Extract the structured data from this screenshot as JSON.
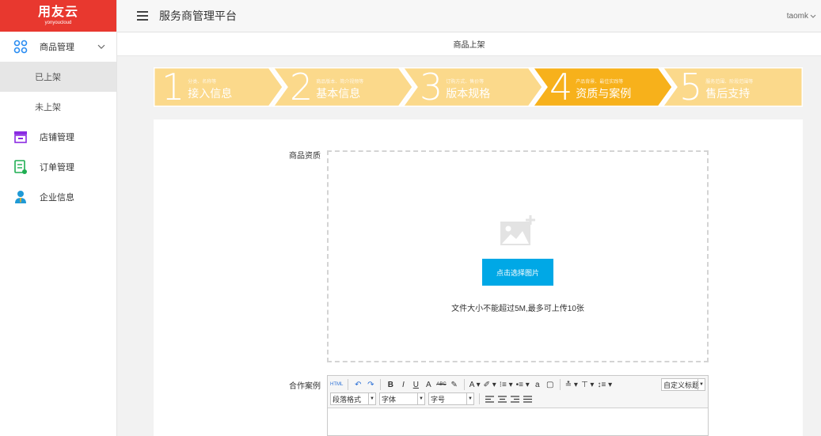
{
  "logo": {
    "main": "用友云",
    "sub": "yonyoucloud"
  },
  "header": {
    "title": "服务商管理平台",
    "user": "taomk"
  },
  "sidebar": {
    "items": [
      {
        "label": "商品管理",
        "icon": "grid-icon",
        "color": "#2a8df2"
      },
      {
        "label": "已上架"
      },
      {
        "label": "未上架"
      },
      {
        "label": "店铺管理",
        "icon": "store-icon",
        "color": "#8a2be2"
      },
      {
        "label": "订单管理",
        "icon": "order-icon",
        "color": "#1fae52"
      },
      {
        "label": "企业信息",
        "icon": "person-icon",
        "color": "#1f9ad6"
      }
    ]
  },
  "page": {
    "title": "商品上架"
  },
  "steps": [
    {
      "num": "1",
      "hint": "分类、名称等",
      "name": "接入信息",
      "active": false
    },
    {
      "num": "2",
      "hint": "商品版本、简介视频等",
      "name": "基本信息",
      "active": false
    },
    {
      "num": "3",
      "hint": "订购方式、售价等",
      "name": "版本规格",
      "active": false
    },
    {
      "num": "4",
      "hint": "产品背景、最佳实践等",
      "name": "资质与案例",
      "active": true
    },
    {
      "num": "5",
      "hint": "服务范围、阶段范围等",
      "name": "售后支持",
      "active": false
    }
  ],
  "colors": {
    "step_inactive": "#fbd98b",
    "step_active": "#f7b11b",
    "primary": "#00a8e6",
    "brand": "#e8382f"
  },
  "form": {
    "qualification_label": "商品资质",
    "upload_button": "点击选择图片",
    "upload_tip": "文件大小不能超过5M,最多可上传10张",
    "case_label": "合作案例"
  },
  "editor": {
    "row1": [
      "HTML",
      "↶",
      "↷",
      "B",
      "I",
      "U",
      "A",
      "ABC",
      "✎",
      "A ▾",
      "✐ ▾",
      "⁝≡ ▾",
      "•≡ ▾",
      "a",
      "▢",
      "≛ ▾",
      "⊤ ▾",
      "↕≡ ▾"
    ],
    "custom_title": "自定义标题",
    "para_format": "段落格式",
    "font_family": "字体",
    "font_size": "字号"
  }
}
